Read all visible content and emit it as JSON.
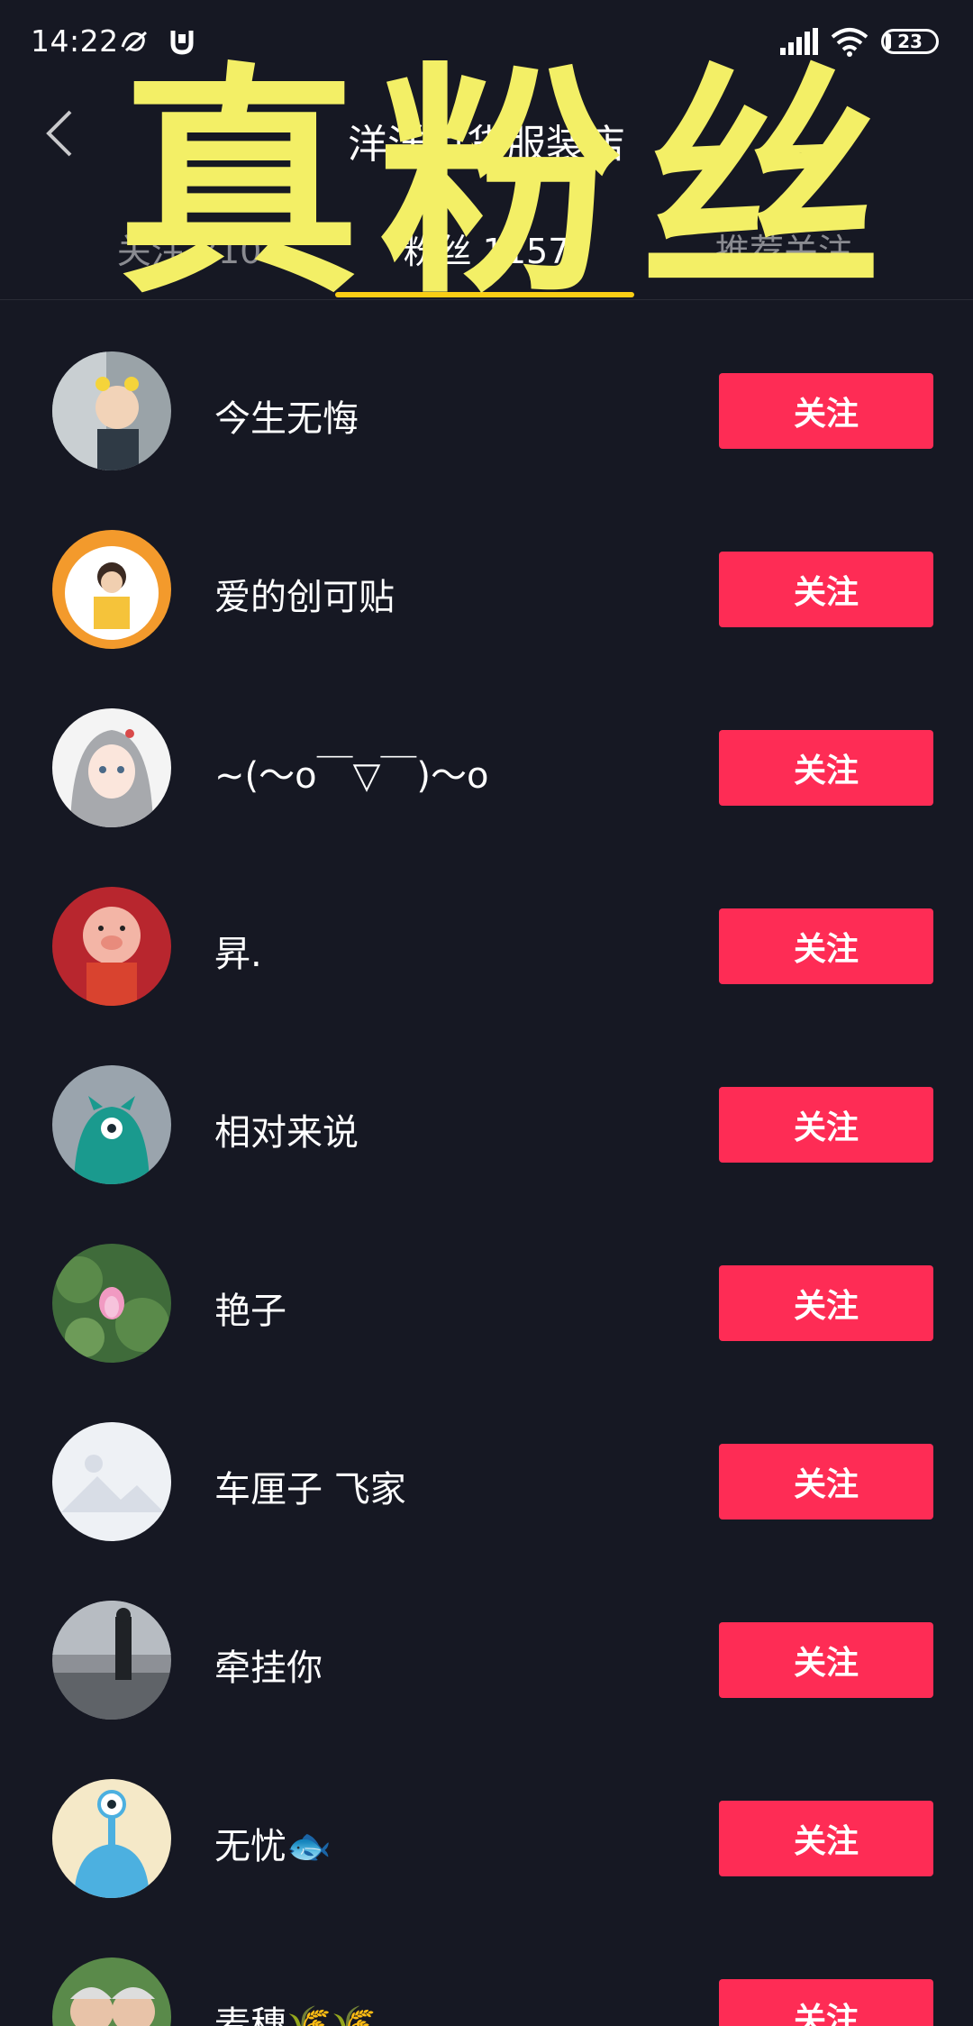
{
  "status_bar": {
    "time": "14:22",
    "battery": "23"
  },
  "header": {
    "title": "洋洋百货服装店"
  },
  "tabs": [
    {
      "label": "关注 310"
    },
    {
      "label": "粉丝 1157"
    },
    {
      "label": "推荐关注"
    }
  ],
  "overlay": {
    "text": "真粉丝"
  },
  "fans": [
    {
      "name": "今生无悔",
      "follow_label": "关注"
    },
    {
      "name": "爱的创可贴",
      "follow_label": "关注"
    },
    {
      "name": "~(〜o￣▽￣)〜o",
      "follow_label": "关注"
    },
    {
      "name": "昇.",
      "follow_label": "关注"
    },
    {
      "name": "相对来说",
      "follow_label": "关注"
    },
    {
      "name": "艳子",
      "follow_label": "关注"
    },
    {
      "name": "车厘子 飞家",
      "follow_label": "关注"
    },
    {
      "name": "牵挂你",
      "follow_label": "关注"
    },
    {
      "name": "无忧🐟",
      "follow_label": "关注"
    },
    {
      "name": "麦穗🌾🌾",
      "follow_label": "关注"
    }
  ],
  "colors": {
    "background": "#161823",
    "follow_button": "#fe2c55",
    "tab_indicator": "#face15",
    "overlay_text": "#f3ef66"
  }
}
